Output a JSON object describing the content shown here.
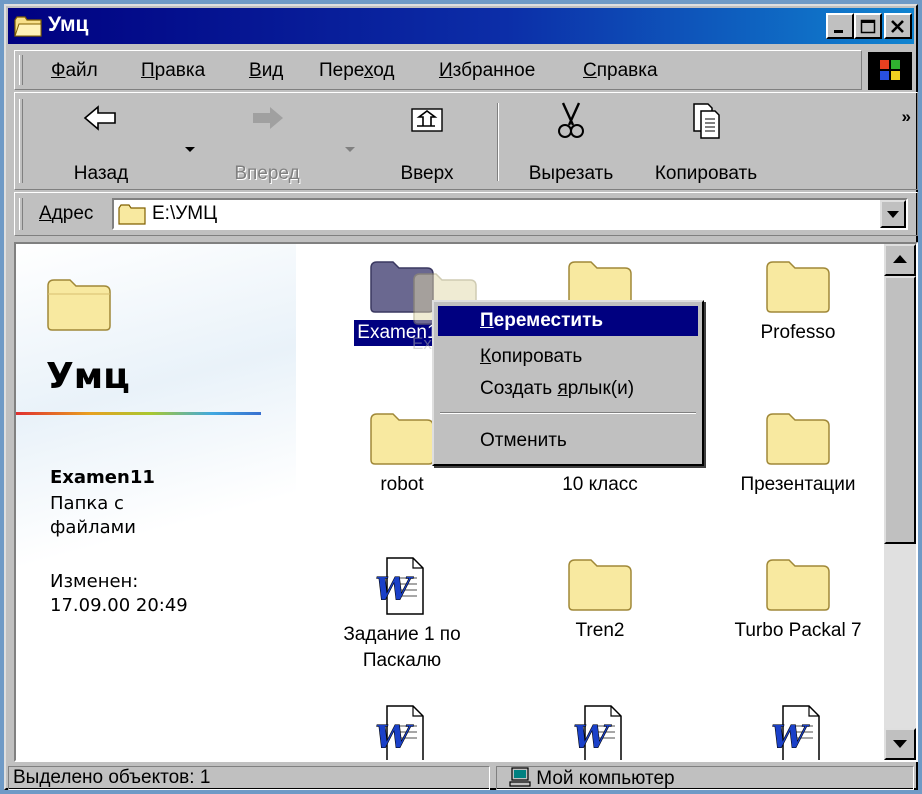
{
  "window": {
    "title": "Умц",
    "icons": {
      "title": "folder-icon",
      "minimize": "minimize-icon",
      "maximize": "maximize-icon",
      "close": "close-icon"
    }
  },
  "menubar": {
    "items": [
      {
        "underline": "Ф",
        "rest": "айл"
      },
      {
        "underline": "П",
        "rest": "равка"
      },
      {
        "underline": "В",
        "rest": "ид"
      },
      {
        "pre": "Пере",
        "underline": "х",
        "rest": "од"
      },
      {
        "underline": "И",
        "rest": "збранное"
      },
      {
        "underline": "С",
        "rest": "правка"
      }
    ]
  },
  "toolbar": {
    "back": "Назад",
    "forward": "Вперед",
    "up": "Вверх",
    "cut": "Вырезать",
    "copy": "Копировать",
    "more": "»"
  },
  "address": {
    "label_underline": "А",
    "label_rest": "дрес",
    "path": "E:\\УМЦ"
  },
  "left_panel": {
    "folder_title": "Умц",
    "selected_name": "Examen11",
    "type_line1": "Папка с",
    "type_line2": "файлами",
    "modified_label": "Изменен:",
    "modified_value": "17.09.00 20:49"
  },
  "files": [
    {
      "name": "Examen11",
      "kind": "folder",
      "selected": true
    },
    {
      "name": "",
      "kind": "folder"
    },
    {
      "name": "Professo",
      "kind": "folder"
    },
    {
      "name": "robot",
      "kind": "folder"
    },
    {
      "name": "10 класс",
      "kind": "folder"
    },
    {
      "name": "Презентации",
      "kind": "folder"
    },
    {
      "name": "Задание 1 по Паскалю",
      "kind": "word-document"
    },
    {
      "name": "Tren2",
      "kind": "folder"
    },
    {
      "name": "Turbo Packal 7",
      "kind": "folder"
    }
  ],
  "drag_ghost": {
    "label": "Exar"
  },
  "context_menu": {
    "items": [
      {
        "underline": "П",
        "rest": "ереместить",
        "active": true
      },
      {
        "underline": "К",
        "rest": "опировать"
      },
      {
        "pre": "Создать ",
        "underline": "я",
        "rest": "рлык(и)"
      },
      {
        "label": "Отменить"
      }
    ]
  },
  "status": {
    "selection": "Выделено объектов: 1",
    "zone": "Мой компьютер",
    "zone_icon": "computer-icon"
  },
  "colors": {
    "titlebar_start": "#000080",
    "titlebar_end": "#1084d0",
    "selection": "#000080",
    "folder": "#f8e9a0",
    "face": "#c0c0c0"
  }
}
